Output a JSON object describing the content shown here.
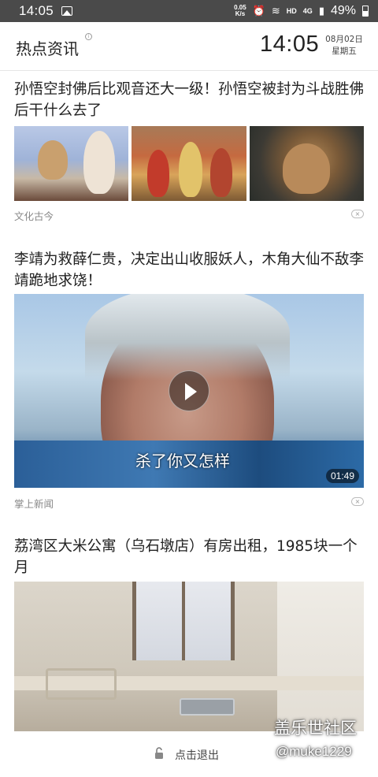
{
  "status_bar": {
    "time": "14:05",
    "net_speed_value": "0.05",
    "net_speed_unit": "K/s",
    "hd_label": "HD",
    "network_label": "4G",
    "battery": "49%"
  },
  "header": {
    "title": "热点资讯",
    "clock": "14:05",
    "date": "08月02日",
    "weekday": "星期五"
  },
  "articles": [
    {
      "title": "孙悟空封佛后比观音还大一级！孙悟空被封为斗战胜佛后干什么去了",
      "source": "文化古今"
    },
    {
      "title": "李靖为救薛仁贵，决定出山收服妖人，木角大仙不敌李靖跪地求饶！",
      "source": "掌上新闻",
      "video_subtitle": "杀了你又怎样",
      "duration": "01:49"
    },
    {
      "title": "荔湾区大米公寓（乌石墩店）有房出租，1985块一个月"
    }
  ],
  "footer": {
    "exit_label": "点击退出",
    "watermark_title": "盖乐世社区",
    "watermark_user": "@muke1229"
  }
}
